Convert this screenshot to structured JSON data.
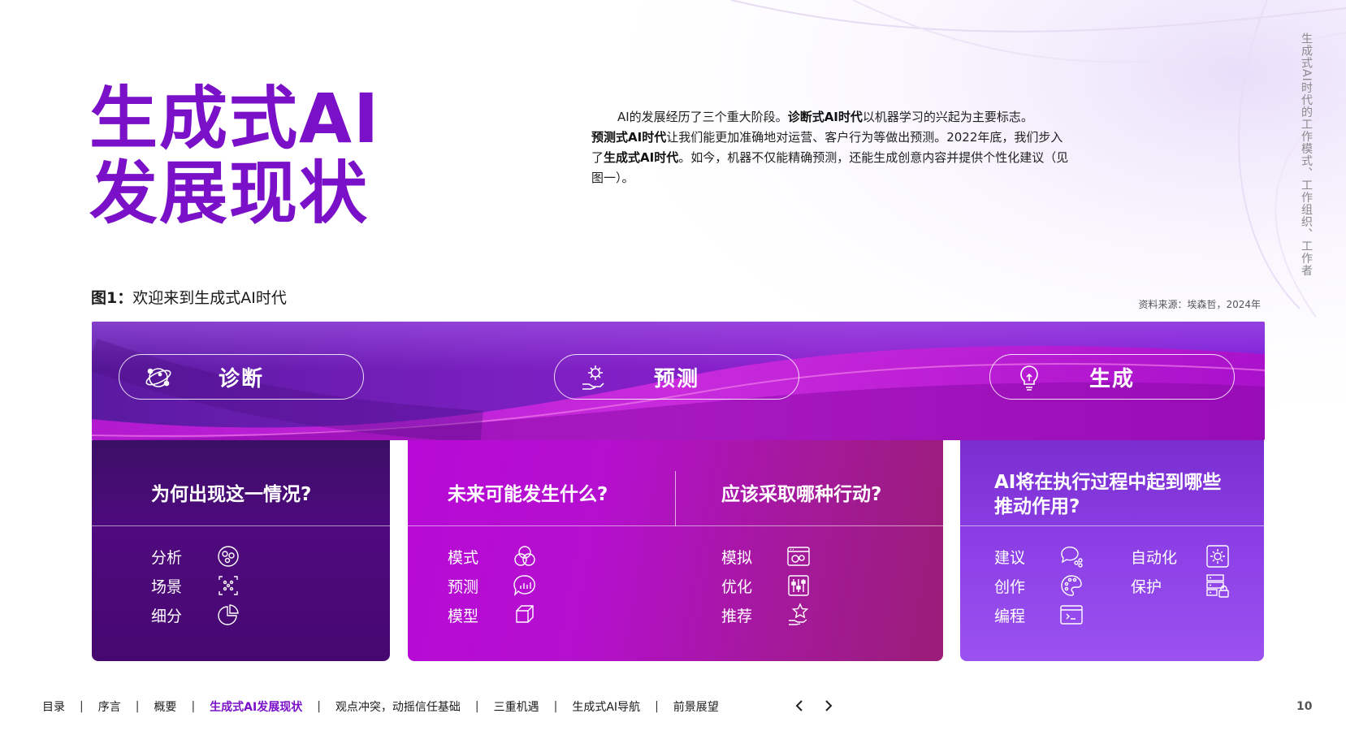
{
  "title": {
    "line1": "生成式AI",
    "line2": "发展现状"
  },
  "intro": {
    "p1_a": "AI的发展经历了三个重大阶段。",
    "p1_b": "诊断式AI时代",
    "p1_c": "以机器学习的兴起为主要标志。",
    "p2_a": "预测式AI时代",
    "p2_b": "让我们能更加准确地对运营、客户行为等做出预测。2022年底，我们步入了",
    "p2_c": "生成式AI时代",
    "p2_d": "。如今，机器不仅能精确预测，还能生成创意内容并提供个性化建议（见图一）。"
  },
  "side_text": "生成式AI时代的工作模式、工作组织、工作者",
  "figure": {
    "caption_bold": "图1：",
    "caption_text": "欢迎来到生成式AI时代",
    "source": "资料来源：埃森哲，2024年"
  },
  "stages": [
    {
      "label": "诊断",
      "icon": "orbit-network-icon"
    },
    {
      "label": "预测",
      "icon": "gear-hand-icon"
    },
    {
      "label": "生成",
      "icon": "lightbulb-icon"
    }
  ],
  "cards": {
    "diagnose": {
      "question": "为何出现这一情况?",
      "items": [
        {
          "label": "分析",
          "icon": "analysis-circle-icon"
        },
        {
          "label": "场景",
          "icon": "scenario-grid-icon"
        },
        {
          "label": "细分",
          "icon": "pie-segment-icon"
        }
      ]
    },
    "predict_left": {
      "question": "未来可能发生什么?",
      "items": [
        {
          "label": "模式",
          "icon": "venn-pattern-icon"
        },
        {
          "label": "预测",
          "icon": "chat-chart-icon"
        },
        {
          "label": "模型",
          "icon": "cube-model-icon"
        }
      ]
    },
    "predict_right": {
      "question": "应该采取哪种行动?",
      "items": [
        {
          "label": "模拟",
          "icon": "simulation-window-icon"
        },
        {
          "label": "优化",
          "icon": "sliders-icon"
        },
        {
          "label": "推荐",
          "icon": "star-hand-icon"
        }
      ]
    },
    "generate": {
      "question": "AI将在执行过程中起到哪些推动作用?",
      "items_left": [
        {
          "label": "建议",
          "icon": "chat-bubbles-icon"
        },
        {
          "label": "创作",
          "icon": "palette-icon"
        },
        {
          "label": "编程",
          "icon": "code-window-icon"
        }
      ],
      "items_right": [
        {
          "label": "自动化",
          "icon": "gear-box-icon"
        },
        {
          "label": "保护",
          "icon": "server-lock-icon"
        }
      ]
    }
  },
  "footer": {
    "nav": [
      "目录",
      "序言",
      "概要",
      "生成式AI发展现状",
      "观点冲突，动摇信任基础",
      "三重机遇",
      "生成式AI导航",
      "前景展望"
    ],
    "active_index": 3,
    "page_number": "10"
  },
  "colors": {
    "brand_purple": "#7a10c8",
    "magenta": "#b70ad6",
    "deep_purple": "#460870",
    "violet": "#8d40e6"
  }
}
